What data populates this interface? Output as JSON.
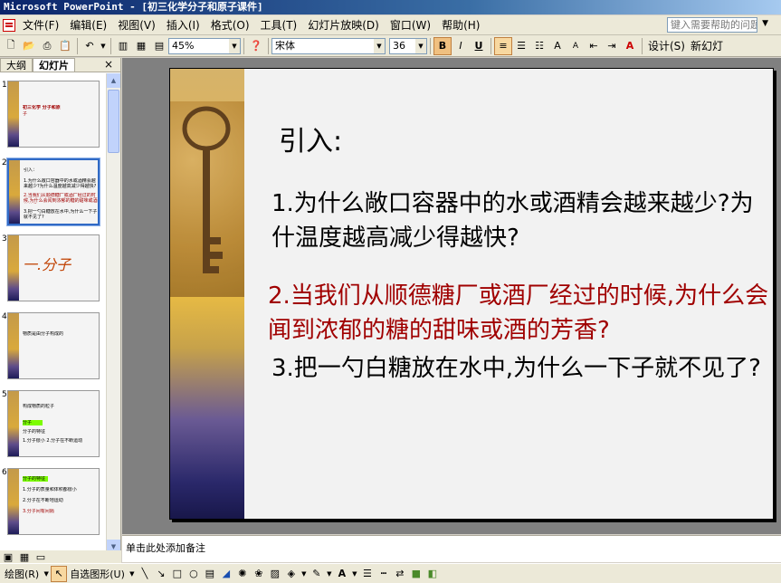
{
  "window": {
    "title": "Microsoft PowerPoint - [初三化学分子和原子课件]"
  },
  "menu": {
    "items": [
      "文件(F)",
      "编辑(E)",
      "视图(V)",
      "插入(I)",
      "格式(O)",
      "工具(T)",
      "幻灯片放映(D)",
      "窗口(W)",
      "帮助(H)"
    ],
    "help_placeholder": "键入需要帮助的问题"
  },
  "toolbar": {
    "zoom": "45%",
    "font_name": "宋体",
    "font_size": "36",
    "bold": "B",
    "italic": "I",
    "underline": "U",
    "design_label": "设计(S)",
    "new_slide_label": "新幻灯"
  },
  "left_pane": {
    "tabs": [
      "大纲",
      "幻灯片"
    ],
    "close": "×",
    "thumbnails": [
      {
        "num": "1",
        "lines": [
          "初三化学     分子和原",
          "子"
        ]
      },
      {
        "num": "2",
        "lines": [
          "引入：",
          "1.为什么敞口容器中的水或酒精会越来越少?为什么温度越高减少得越快?",
          "2.当我们从顺德糖厂或酒厂经过的时候,为什么会闻到浓郁的糖的甜味或酒的芳香?",
          "3.把一勺白糖放在水中,为什么一下子就不见了?"
        ]
      },
      {
        "num": "3",
        "lines": [
          "一.分子"
        ]
      },
      {
        "num": "4",
        "lines": [
          "物质是由分子构成的",
          ""
        ]
      },
      {
        "num": "5",
        "lines": [
          "构成物质的粒子",
          "分子",
          "分子的特征",
          "1.分子很小 2.分子在不断运动"
        ]
      },
      {
        "num": "6",
        "lines": [
          "分子的特征",
          "1.分子的质量和体积都很小",
          "2.分子在不断地运动",
          "3.分子间有间隔"
        ]
      }
    ]
  },
  "slide": {
    "heading": "引入:",
    "questions": [
      "1.为什么敞口容器中的水或酒精会越来越少?为什温度越高减少得越快?",
      "2.当我们从顺德糖厂或酒厂经过的时候,为什么会闻到浓郁的糖的甜味或酒的芳香?",
      "3.把一勺白糖放在水中,为什么一下子就不见了?"
    ],
    "colors": {
      "question2": "#a00000",
      "strip_top": "#d6b36a",
      "strip_bottom": "#18174a"
    }
  },
  "notes": {
    "placeholder": "单击此处添加备注"
  },
  "drawing_bar": {
    "draw_label": "绘图(R)",
    "autoshapes_label": "自选图形(U)"
  }
}
